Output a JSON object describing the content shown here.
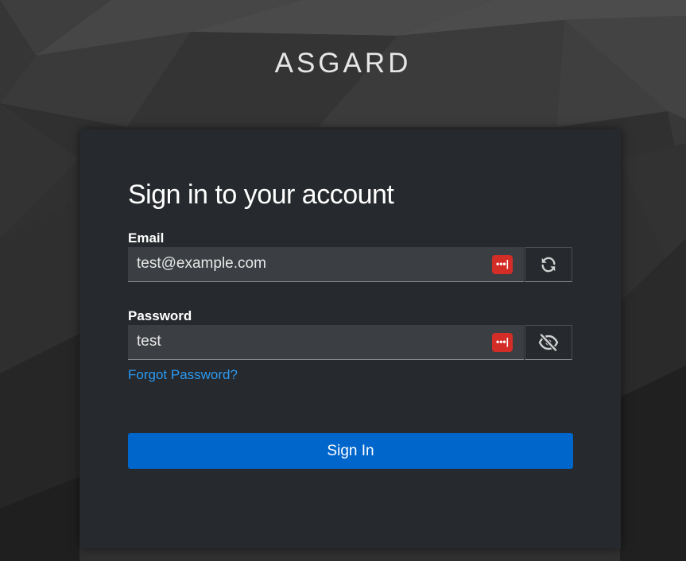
{
  "brand": {
    "name": "ASGARD"
  },
  "login": {
    "title": "Sign in to your account",
    "email": {
      "label": "Email",
      "value": "test@example.com",
      "manager_badge": "•••|"
    },
    "password": {
      "label": "Password",
      "value": "test",
      "manager_badge": "•••|"
    },
    "forgot_link": "Forgot Password?",
    "submit_label": "Sign In"
  },
  "icons": {
    "refresh": "refresh-icon",
    "visibility": "eye-slash-icon",
    "password_manager": "password-manager-icon"
  },
  "colors": {
    "card_bg": "#26292d",
    "input_bg": "#3b3e42",
    "primary": "#0066cc",
    "link": "#2b9af3",
    "badge": "#d32d27"
  }
}
